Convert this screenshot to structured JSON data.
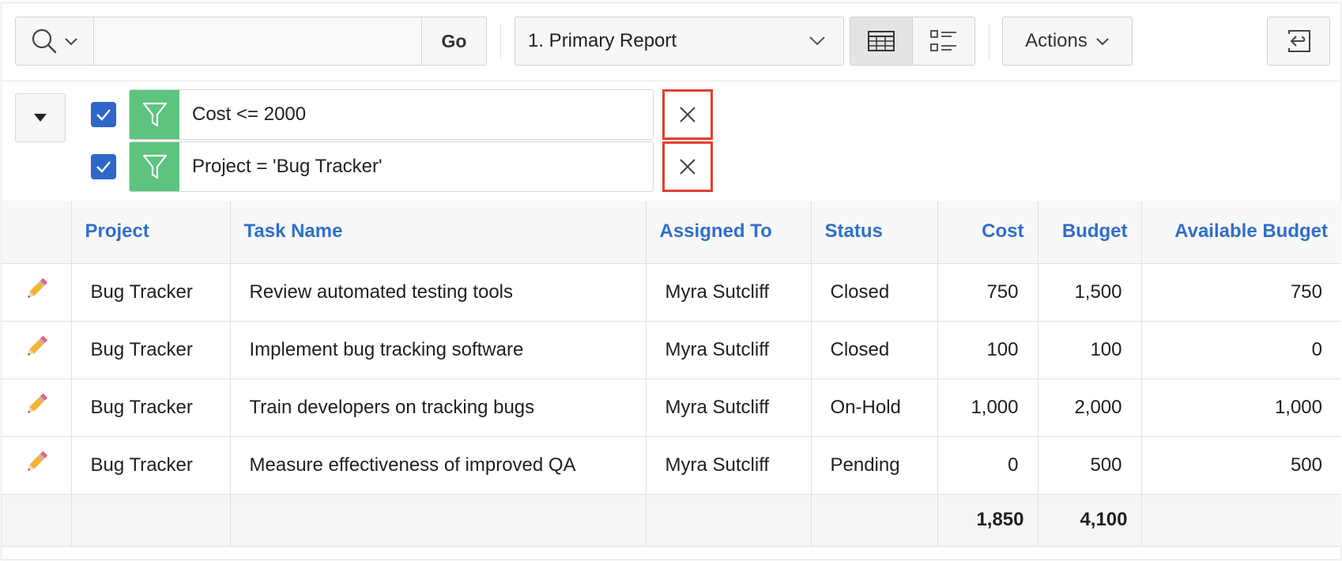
{
  "toolbar": {
    "search_value": "",
    "go_label": "Go",
    "report_selected": "1. Primary Report",
    "actions_label": "Actions"
  },
  "filters": [
    {
      "checked": true,
      "label": "Cost <= 2000"
    },
    {
      "checked": true,
      "label": "Project = 'Bug Tracker'"
    }
  ],
  "table": {
    "columns": [
      "Project",
      "Task Name",
      "Assigned To",
      "Status",
      "Cost",
      "Budget",
      "Available Budget"
    ],
    "rows": [
      [
        "Bug Tracker",
        "Review automated testing tools",
        "Myra Sutcliff",
        "Closed",
        "750",
        "1,500",
        "750"
      ],
      [
        "Bug Tracker",
        "Implement bug tracking software",
        "Myra Sutcliff",
        "Closed",
        "100",
        "100",
        "0"
      ],
      [
        "Bug Tracker",
        "Train developers on tracking bugs",
        "Myra Sutcliff",
        "On-Hold",
        "1,000",
        "2,000",
        "1,000"
      ],
      [
        "Bug Tracker",
        "Measure effectiveness of improved QA",
        "Myra Sutcliff",
        "Pending",
        "0",
        "500",
        "500"
      ]
    ],
    "totals": {
      "cost": "1,850",
      "budget": "4,100"
    }
  },
  "colors": {
    "link": "#2f6fcb",
    "filter_green": "#5cc47e",
    "checkbox_blue": "#2f66c7",
    "highlight_red": "#e0402f"
  },
  "icons": {
    "search": "search-icon",
    "filter": "funnel-icon",
    "remove": "close-icon",
    "edit": "pencil-icon",
    "view_grid": "grid-view-icon",
    "view_detail": "detail-view-icon",
    "reset": "reset-icon",
    "collapse": "triangle-down-icon"
  }
}
